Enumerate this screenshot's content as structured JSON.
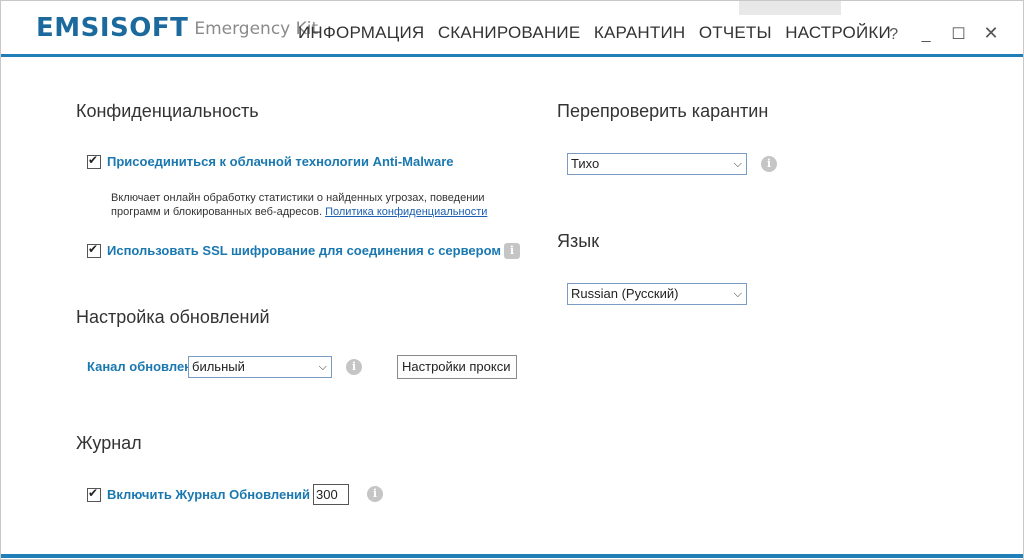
{
  "app": {
    "brand": "EMSISOFT",
    "subtitle": "Emergency Kit"
  },
  "nav": {
    "items": [
      "ИНФОРМАЦИЯ",
      "СКАНИРОВАНИЕ",
      "КАРАНТИН",
      "ОТЧЕТЫ",
      "НАСТРОЙКИ"
    ],
    "active": "НАСТРОЙКИ"
  },
  "window_controls": {
    "help": "?",
    "minimize": "_",
    "maximize": "☐",
    "close": "✕"
  },
  "privacy": {
    "title": "Конфиденциальность",
    "cloud_label": "Присоединиться к облачной технологии Anti-Malware",
    "cloud_checked": true,
    "cloud_desc_line1": "Включает онлайн обработку статистики о найденных угрозах, поведении",
    "cloud_desc_line2": "программ и блокированных веб-адресов.",
    "policy_link": "Политика конфиденциальности",
    "ssl_label": "Использовать SSL шифрование для соединения с сервером",
    "ssl_checked": true
  },
  "updates": {
    "title": "Настройка обновлений",
    "channel_label": "Канал обновления:",
    "channel_value": "бильный",
    "proxy_button": "Настройки прокси"
  },
  "journal": {
    "title": "Журнал",
    "enable_label": "Включить Журнал Обновлений",
    "enable_checked": true,
    "count_value": "300"
  },
  "quarantine": {
    "title": "Перепроверить карантин",
    "mode_value": "Тихо"
  },
  "language": {
    "title": "Язык",
    "value": "Russian (Русский)"
  },
  "colors": {
    "accent": "#1f7fb6",
    "link": "#1a78b0"
  }
}
